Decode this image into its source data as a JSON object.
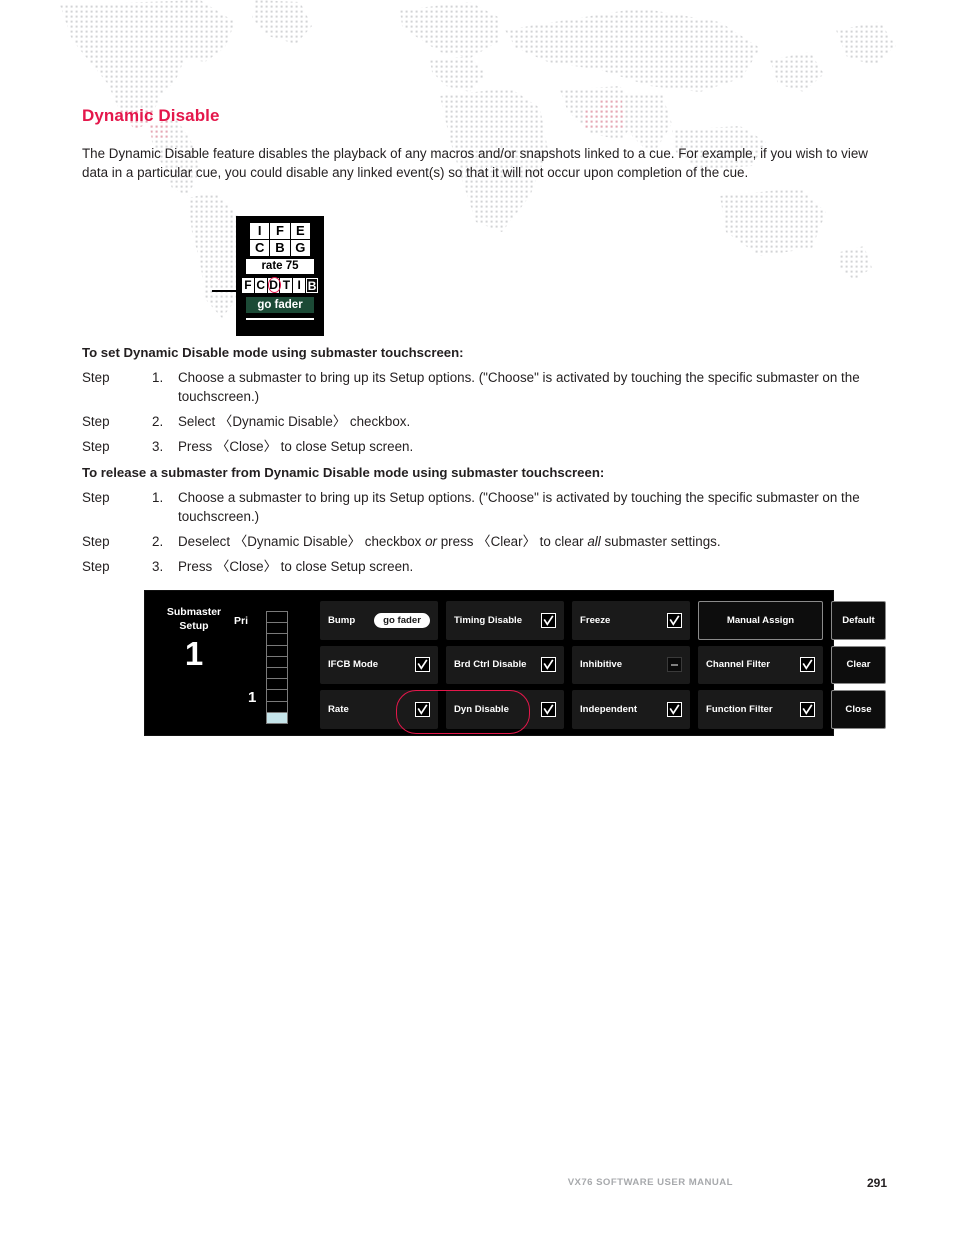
{
  "heading": "Dynamic Disable",
  "intro_paragraph": "The Dynamic Disable feature disables the playback of any macros and/or snapshots linked to a cue. For example, if you wish to view data in a particular cue, you could disable any linked event(s) so that it will not occur upon completion of the cue.",
  "lcd": {
    "letters_grid": [
      "I",
      "F",
      "E",
      "C",
      "B",
      "G"
    ],
    "rate_label": "rate 75",
    "status_letters": [
      "F",
      "C",
      "D",
      "T",
      "I",
      "B"
    ],
    "circled_letter": "D",
    "go_fader_label": "go fader",
    "circle_color": "#E4174B"
  },
  "procedures": [
    {
      "title": "To set Dynamic Disable mode using submaster touchscreen:",
      "steps": [
        {
          "label": "Step",
          "number": "1.",
          "text": "Choose a submaster to bring up its Setup options. (\"Choose\" is activated by touching the specific submaster on the touchscreen.)"
        },
        {
          "label": "Step",
          "number": "2.",
          "text": "Select 〈Dynamic Disable〉 checkbox."
        },
        {
          "label": "Step",
          "number": "3.",
          "text": "Press 〈Close〉 to close Setup screen."
        }
      ]
    },
    {
      "title": "To release a submaster from Dynamic Disable mode using submaster touchscreen:",
      "steps": [
        {
          "label": "Step",
          "number": "1.",
          "text": "Choose a submaster to bring up its Setup options. (\"Choose\" is activated by touching the specific submaster on the touchscreen.)"
        },
        {
          "label": "Step",
          "number": "2.",
          "text_parts": [
            "Deselect 〈Dynamic Disable〉 checkbox ",
            "or",
            " press 〈Clear〉 to clear ",
            "all",
            " submaster settings."
          ],
          "text": "Deselect 〈Dynamic Disable〉 checkbox or press 〈Clear〉 to clear all submaster settings."
        },
        {
          "label": "Step",
          "number": "3.",
          "text": "Press 〈Close〉 to close Setup screen."
        }
      ]
    }
  ],
  "submaster_panel": {
    "title_line1": "Submaster",
    "title_line2": "Setup",
    "submaster_number": "1",
    "priority_label": "Pri",
    "fader_value": "1",
    "fader_segments": 10,
    "fader_filled_index": 9,
    "fader_fill_color": "#c5e4ea",
    "highlighted_button": "Dyn Disable",
    "highlight_color": "#E4174B",
    "buttons": [
      {
        "label": "Bump",
        "control": "pill",
        "pill_label": "go fader",
        "style": "filled"
      },
      {
        "label": "Timing Disable",
        "control": "check",
        "checked": true,
        "style": "filled"
      },
      {
        "label": "Freeze",
        "control": "check",
        "checked": true,
        "style": "filled"
      },
      {
        "label": "Manual Assign",
        "control": "none",
        "style": "outlined"
      },
      {
        "label": "Default",
        "control": "none",
        "style": "small-outlined"
      },
      {
        "label": "IFCB Mode",
        "control": "check",
        "checked": true,
        "style": "filled"
      },
      {
        "label": "Brd Ctrl Disable",
        "control": "check",
        "checked": true,
        "style": "filled"
      },
      {
        "label": "Inhibitive",
        "control": "dash",
        "checked": false,
        "style": "filled"
      },
      {
        "label": "Channel Filter",
        "control": "check",
        "checked": true,
        "style": "filled"
      },
      {
        "label": "Clear",
        "control": "none",
        "style": "small-outlined"
      },
      {
        "label": "Rate",
        "control": "check",
        "checked": true,
        "style": "filled"
      },
      {
        "label": "Dyn Disable",
        "control": "check",
        "checked": true,
        "style": "filled"
      },
      {
        "label": "Independent",
        "control": "check",
        "checked": true,
        "style": "filled"
      },
      {
        "label": "Function Filter",
        "control": "check",
        "checked": true,
        "style": "filled"
      },
      {
        "label": "Close",
        "control": "none",
        "style": "small-outlined"
      }
    ]
  },
  "footer": {
    "manual_title": "VX76 SOFTWARE USER MANUAL",
    "page_number": "291"
  }
}
